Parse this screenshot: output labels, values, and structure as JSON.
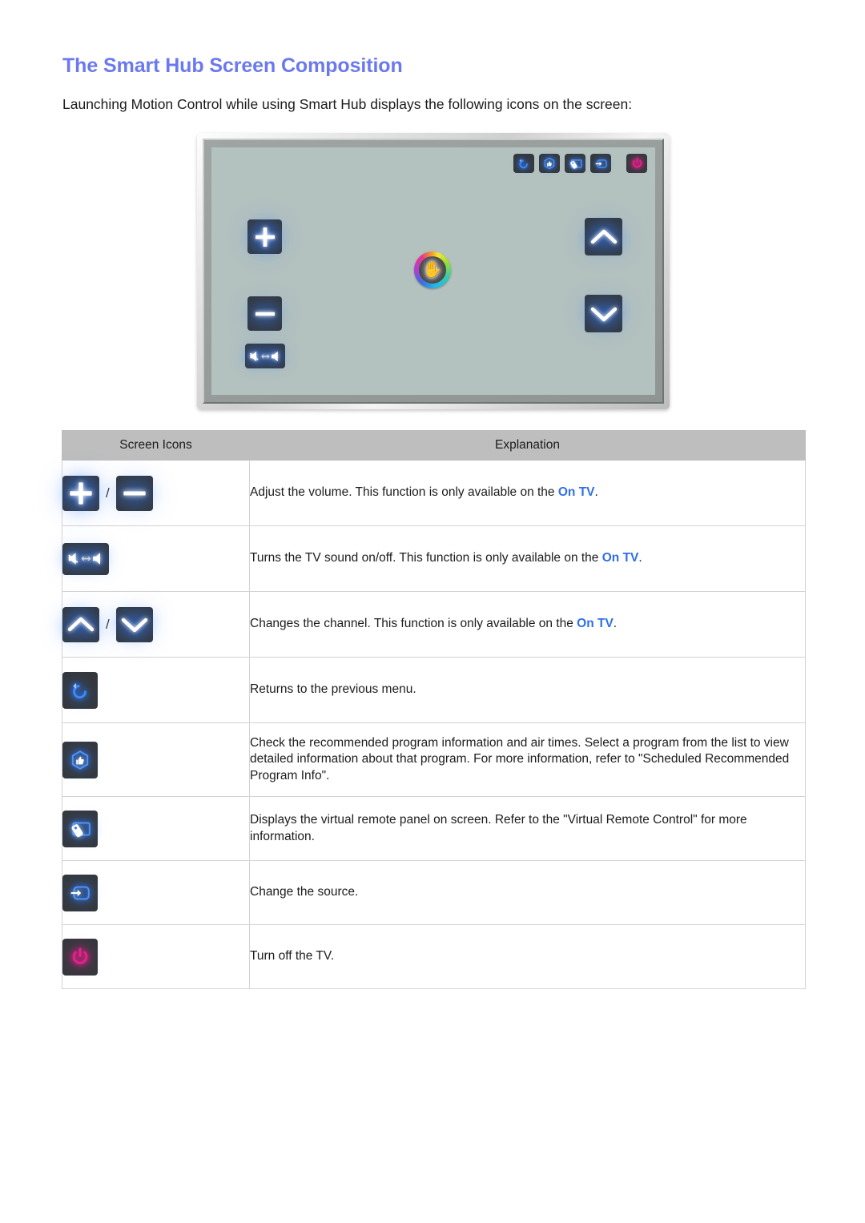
{
  "document": {
    "title": "The Smart Hub Screen Composition",
    "intro": "Launching Motion Control while using Smart Hub displays the following icons on the screen:"
  },
  "colors": {
    "heading": "#6b79ef",
    "link_on_tv": "#2f6fe8",
    "icon_glow_blue": "#2f7bff",
    "icon_power_magenta": "#ec1e8c",
    "icon_button_bg": "#34383d",
    "table_header_bg": "#bebebe",
    "tv_screen_bg": "#b3c1bf"
  },
  "tv_illustration": {
    "name": "smart-hub-motion-control-screen",
    "toolbar": [
      {
        "icon": "return-icon",
        "label": "Return"
      },
      {
        "icon": "recommended-program-icon",
        "label": "Recommendations"
      },
      {
        "icon": "virtual-remote-icon",
        "label": "Virtual Remote"
      },
      {
        "icon": "source-icon",
        "label": "Source"
      },
      {
        "icon": "power-icon",
        "label": "Power"
      }
    ],
    "controls": [
      {
        "icon": "volume-up-icon",
        "label": "Volume Up"
      },
      {
        "icon": "volume-down-icon",
        "label": "Volume Down"
      },
      {
        "icon": "mute-toggle-icon",
        "label": "Mute On/Off"
      },
      {
        "icon": "channel-up-icon",
        "label": "Channel Up"
      },
      {
        "icon": "channel-down-icon",
        "label": "Channel Down"
      }
    ],
    "cursor": {
      "icon": "hand-cursor-icon",
      "label": "Motion Control hand cursor"
    }
  },
  "table": {
    "headers": {
      "icons": "Screen Icons",
      "explanation": "Explanation"
    },
    "rows": [
      {
        "icons": [
          "volume-up-icon",
          "volume-down-icon"
        ],
        "separator": "/",
        "text_before": "Adjust the volume. This function is only available on the ",
        "link": "On TV",
        "text_after": "."
      },
      {
        "icons": [
          "mute-toggle-icon"
        ],
        "separator": "",
        "text_before": "Turns the TV sound on/off. This function is only available on the ",
        "link": "On TV",
        "text_after": "."
      },
      {
        "icons": [
          "channel-up-icon",
          "channel-down-icon"
        ],
        "separator": "/",
        "text_before": "Changes the channel. This function is only available on the ",
        "link": "On TV",
        "text_after": "."
      },
      {
        "icons": [
          "return-icon"
        ],
        "separator": "",
        "text_before": "Returns to the previous menu.",
        "link": "",
        "text_after": ""
      },
      {
        "icons": [
          "recommended-program-icon"
        ],
        "separator": "",
        "text_before": "Check the recommended program information and air times. Select a program from the list to view detailed information about that program. For more information, refer to \"Scheduled Recommended Program Info\".",
        "link": "",
        "text_after": ""
      },
      {
        "icons": [
          "virtual-remote-icon"
        ],
        "separator": "",
        "text_before": "Displays the virtual remote panel on screen. Refer to the \"Virtual Remote Control\" for more information.",
        "link": "",
        "text_after": ""
      },
      {
        "icons": [
          "source-icon"
        ],
        "separator": "",
        "text_before": "Change the source.",
        "link": "",
        "text_after": ""
      },
      {
        "icons": [
          "power-icon"
        ],
        "separator": "",
        "text_before": "Turn off the TV.",
        "link": "",
        "text_after": ""
      }
    ]
  }
}
